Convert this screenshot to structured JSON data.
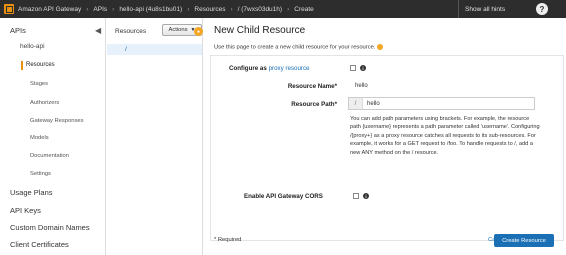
{
  "topbar": {
    "breadcrumbs": [
      "Amazon API Gateway",
      "APIs",
      "hello-api (4u8s1bu01)",
      "Resources",
      "/ (7wxs03du1h)",
      "Create"
    ],
    "show_hints": "Show all hints",
    "help": "?"
  },
  "nav": {
    "apis_label": "APIs",
    "collapse_glyph": "◀",
    "api_name": "hello-api",
    "subitems": [
      "Resources",
      "Stages",
      "Authorizers",
      "Gateway Responses",
      "Models",
      "Documentation",
      "Settings"
    ],
    "main_items": [
      "Usage Plans",
      "API Keys",
      "Custom Domain Names",
      "Client Certificates"
    ]
  },
  "tree": {
    "title": "Resources",
    "actions_label": "Actions",
    "root": "/"
  },
  "content": {
    "title": "New Child Resource",
    "intro": "Use this page to create a new child resource for your resource.",
    "configure_label": "Configure as",
    "configure_link": "proxy resource",
    "resource_name_label": "Resource Name*",
    "resource_name_value": "hello",
    "resource_path_label": "Resource Path*",
    "resource_path_prefix": "/",
    "resource_path_value": "hello",
    "help_text": "You can add path parameters using brackets. For example, the resource path {username} represents a path parameter called 'username'. Configuring /{proxy+} as a proxy resource catches all requests to its sub-resources. For example, it works for a GET request to /foo. To handle requests to /, add a new ANY method on the / resource.",
    "cors_label": "Enable API Gateway CORS",
    "required_note": "* Required",
    "cancel_label": "Cancel",
    "create_label": "Create Resource"
  }
}
